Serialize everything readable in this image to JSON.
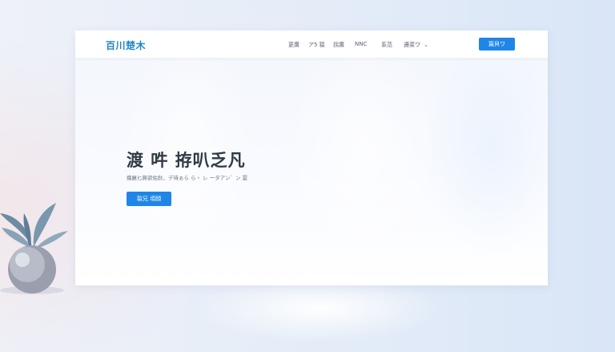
{
  "header": {
    "logo": "百川楚木",
    "nav": [
      "更廣",
      "ア5 猿",
      "拐廣",
      "NNC",
      "系范",
      "遵菜ワ"
    ],
    "cta": "篇貝ワ"
  },
  "hero": {
    "title": "渡 吽 拵叭乏凡",
    "subtitle": "撸匾匕蔣欲佑鈥、デ待ぁら ら・ レ ータアン゛ン 冨",
    "button": "裂兄 頃顔"
  },
  "icons": {
    "nav_dropdown": "chevron-down-icon"
  },
  "colors": {
    "primary": "#1f86e8",
    "logo": "#1f86c9"
  }
}
